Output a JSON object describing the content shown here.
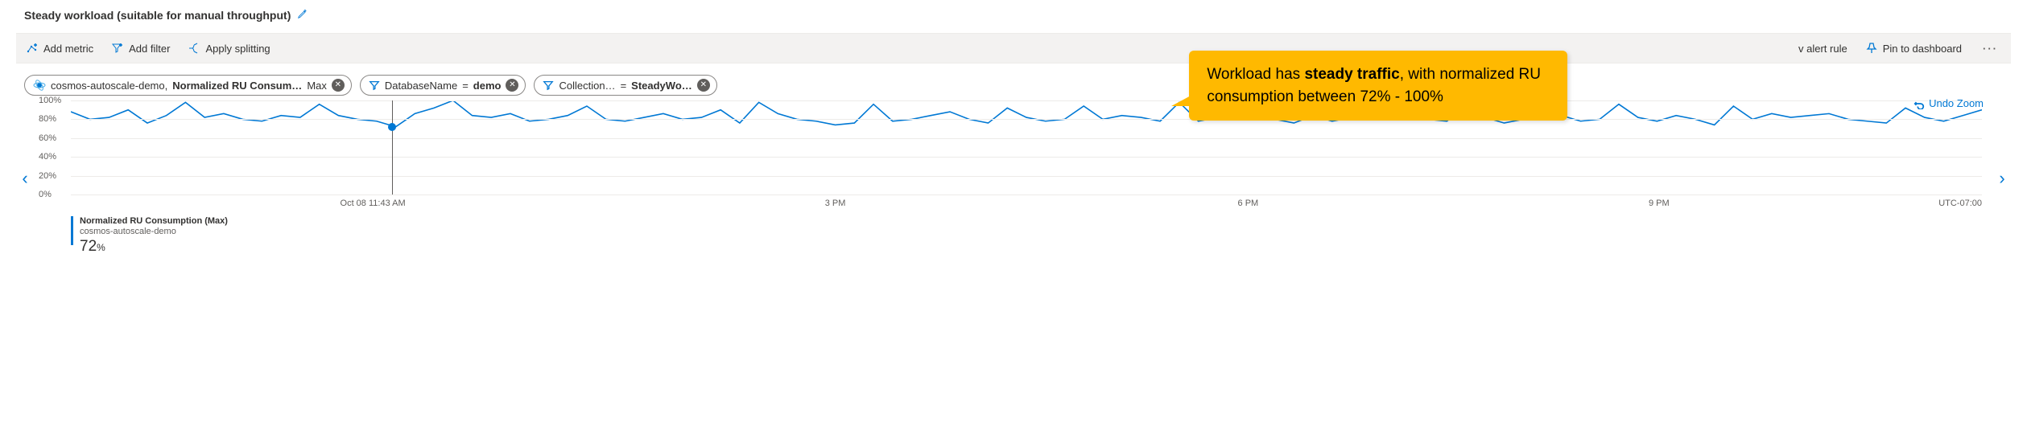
{
  "title": "Steady workload (suitable for manual throughput)",
  "toolbar": {
    "add_metric": "Add metric",
    "add_filter": "Add filter",
    "apply_splitting": "Apply splitting",
    "alert_rule": "v alert rule",
    "pin": "Pin to dashboard"
  },
  "pills": {
    "resource": "cosmos-autoscale-demo,",
    "metric": "Normalized RU Consum…",
    "agg": "Max",
    "db_label": "DatabaseName",
    "db_val": "demo",
    "coll_label": "Collection…",
    "coll_val": "SteadyWo…"
  },
  "callout": {
    "prefix": "Workload has ",
    "bold": "steady traffic",
    "suffix": ", with normalized RU consumption between 72% - 100%"
  },
  "undo_zoom": "Undo Zoom",
  "legend": {
    "name": "Normalized RU Consumption (Max)",
    "resource": "cosmos-autoscale-demo",
    "value": "72",
    "unit": "%"
  },
  "timezone": "UTC-07:00",
  "chart_data": {
    "type": "line",
    "title": "Normalized RU Consumption (Max)",
    "ylabel": "%",
    "ylim": [
      0,
      100
    ],
    "yticks": [
      0,
      20,
      40,
      60,
      80,
      100
    ],
    "xticks": [
      "Oct 08 11:43 AM",
      "3 PM",
      "6 PM",
      "9 PM"
    ],
    "xtick_positions_pct": [
      15.8,
      40.0,
      61.6,
      83.1
    ],
    "cursor_x_pct": 16.8,
    "cursor_y_val": 72,
    "series": [
      {
        "name": "Normalized RU Consumption (Max)",
        "x_pct": [
          0,
          1,
          2,
          3,
          4,
          5,
          6,
          7,
          8,
          9,
          10,
          11,
          12,
          13,
          14,
          15,
          16,
          17,
          18,
          19,
          20,
          21,
          22,
          23,
          24,
          25,
          26,
          27,
          28,
          29,
          30,
          31,
          32,
          33,
          34,
          35,
          36,
          37,
          38,
          39,
          40,
          41,
          42,
          43,
          44,
          45,
          46,
          47,
          48,
          49,
          50,
          51,
          52,
          53,
          54,
          55,
          56,
          57,
          58,
          59,
          60,
          61,
          62,
          63,
          64,
          65,
          66,
          67,
          68,
          69,
          70,
          71,
          72,
          73,
          74,
          75,
          76,
          77,
          78,
          79,
          80,
          81,
          82,
          83,
          84,
          85,
          86,
          87,
          88,
          89,
          90,
          91,
          92,
          93,
          94,
          95,
          96,
          97,
          98,
          99,
          100
        ],
        "values": [
          88,
          80,
          82,
          90,
          76,
          84,
          98,
          82,
          86,
          80,
          78,
          84,
          82,
          96,
          84,
          80,
          78,
          72,
          86,
          92,
          100,
          84,
          82,
          86,
          78,
          80,
          84,
          94,
          80,
          78,
          82,
          86,
          80,
          82,
          90,
          76,
          98,
          86,
          80,
          78,
          74,
          76,
          96,
          78,
          80,
          84,
          88,
          80,
          76,
          92,
          82,
          78,
          80,
          94,
          80,
          84,
          82,
          78,
          98,
          78,
          82,
          86,
          92,
          80,
          76,
          84,
          78,
          82,
          80,
          84,
          98,
          80,
          78,
          94,
          82,
          76,
          80,
          86,
          84,
          78,
          80,
          96,
          82,
          78,
          84,
          80,
          74,
          94,
          80,
          86,
          82,
          84,
          86,
          80,
          78,
          76,
          92,
          82,
          78,
          84,
          90
        ]
      }
    ]
  }
}
